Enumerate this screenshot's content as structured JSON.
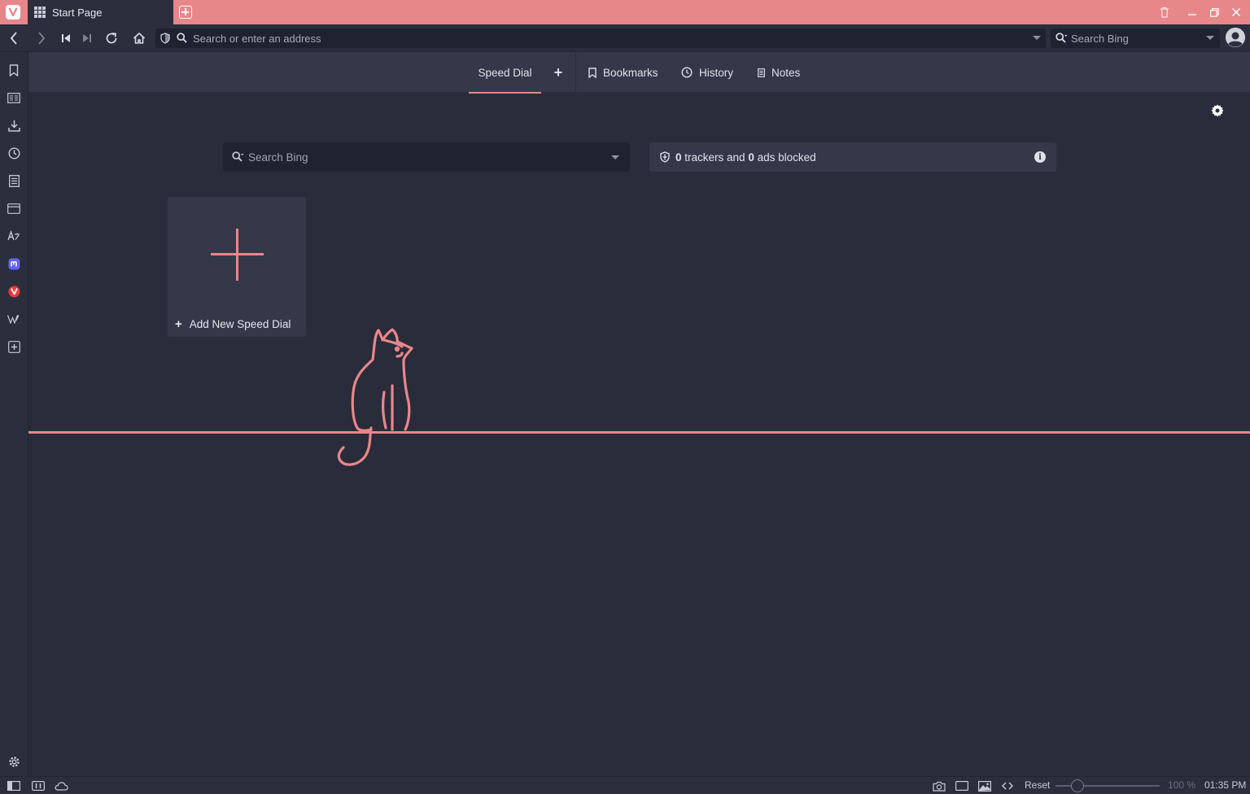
{
  "window": {
    "tab_title": "Start Page",
    "accent_color": "#e8878a",
    "background_color": "#292c3b"
  },
  "toolbar": {
    "address_placeholder": "Search or enter an address",
    "search_placeholder": "Search Bing"
  },
  "startpage": {
    "tabs": [
      {
        "label": "Speed Dial",
        "icon": "none",
        "active": true
      },
      {
        "label": "Bookmarks",
        "icon": "bookmark-icon"
      },
      {
        "label": "History",
        "icon": "clock-icon"
      },
      {
        "label": "Notes",
        "icon": "note-icon"
      }
    ],
    "add_group_label": "+",
    "search_placeholder": "Search Bing",
    "tracker": {
      "trackers_count": "0",
      "trackers_text": "trackers and",
      "ads_count": "0",
      "ads_text": "ads blocked"
    },
    "add_dial_label": "Add New Speed Dial"
  },
  "sidebar": {
    "items": [
      "bookmark-icon",
      "reading-list-icon",
      "download-icon",
      "history-icon",
      "notes-icon",
      "window-panel-icon",
      "translate-icon",
      "mastodon-icon",
      "vivaldi-icon",
      "wikipedia-icon",
      "add-panel-icon",
      "settings-icon"
    ]
  },
  "statusbar": {
    "reset_label": "Reset",
    "zoom_level": "100 %",
    "clock": "01:35 PM"
  }
}
